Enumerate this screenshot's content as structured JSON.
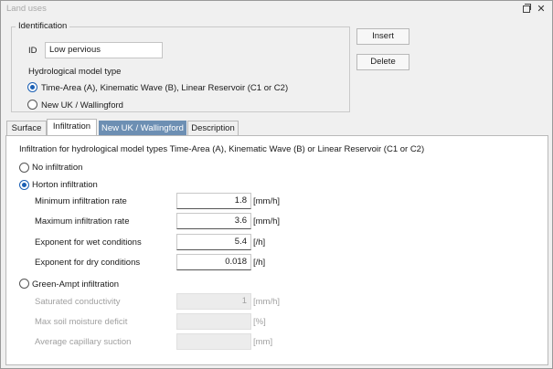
{
  "window": {
    "title": "Land uses"
  },
  "identification": {
    "legend": "Identification",
    "id_label": "ID",
    "id_value": "Low pervious",
    "model_type_label": "Hydrological model type",
    "model_options": [
      {
        "label": "Time-Area (A), Kinematic Wave (B), Linear Reservoir (C1 or C2)",
        "selected": true
      },
      {
        "label": "New UK / Wallingford",
        "selected": false
      }
    ]
  },
  "buttons": {
    "insert": "Insert",
    "delete": "Delete"
  },
  "tabs": [
    {
      "label": "Surface",
      "state": "normal"
    },
    {
      "label": "Infiltration",
      "state": "active"
    },
    {
      "label": "New UK / Wallingford",
      "state": "hover"
    },
    {
      "label": "Description",
      "state": "normal"
    }
  ],
  "infiltration": {
    "heading": "Infiltration for hydrological model types Time-Area (A), Kinematic Wave (B) or Linear Reservoir (C1 or C2)",
    "options": {
      "none": "No infiltration",
      "horton": "Horton infiltration",
      "green_ampt": "Green-Ampt infiltration"
    },
    "selected": "horton",
    "horton_fields": [
      {
        "label": "Minimum infiltration rate",
        "value": "1.8",
        "unit": "[mm/h]"
      },
      {
        "label": "Maximum infiltration rate",
        "value": "3.6",
        "unit": "[mm/h]"
      },
      {
        "label": "Exponent for wet conditions",
        "value": "5.4",
        "unit": "[/h]"
      },
      {
        "label": "Exponent for dry conditions",
        "value": "0.018",
        "unit": "[/h]"
      }
    ],
    "green_ampt_fields": [
      {
        "label": "Saturated conductivity",
        "value": "1",
        "unit": "[mm/h]"
      },
      {
        "label": "Max soil moisture deficit",
        "value": "",
        "unit": "[%]"
      },
      {
        "label": "Average capillary suction",
        "value": "",
        "unit": "[mm]"
      }
    ]
  },
  "colors": {
    "accent": "#1a5fb4",
    "tab_hover": "#6d8fb3"
  }
}
